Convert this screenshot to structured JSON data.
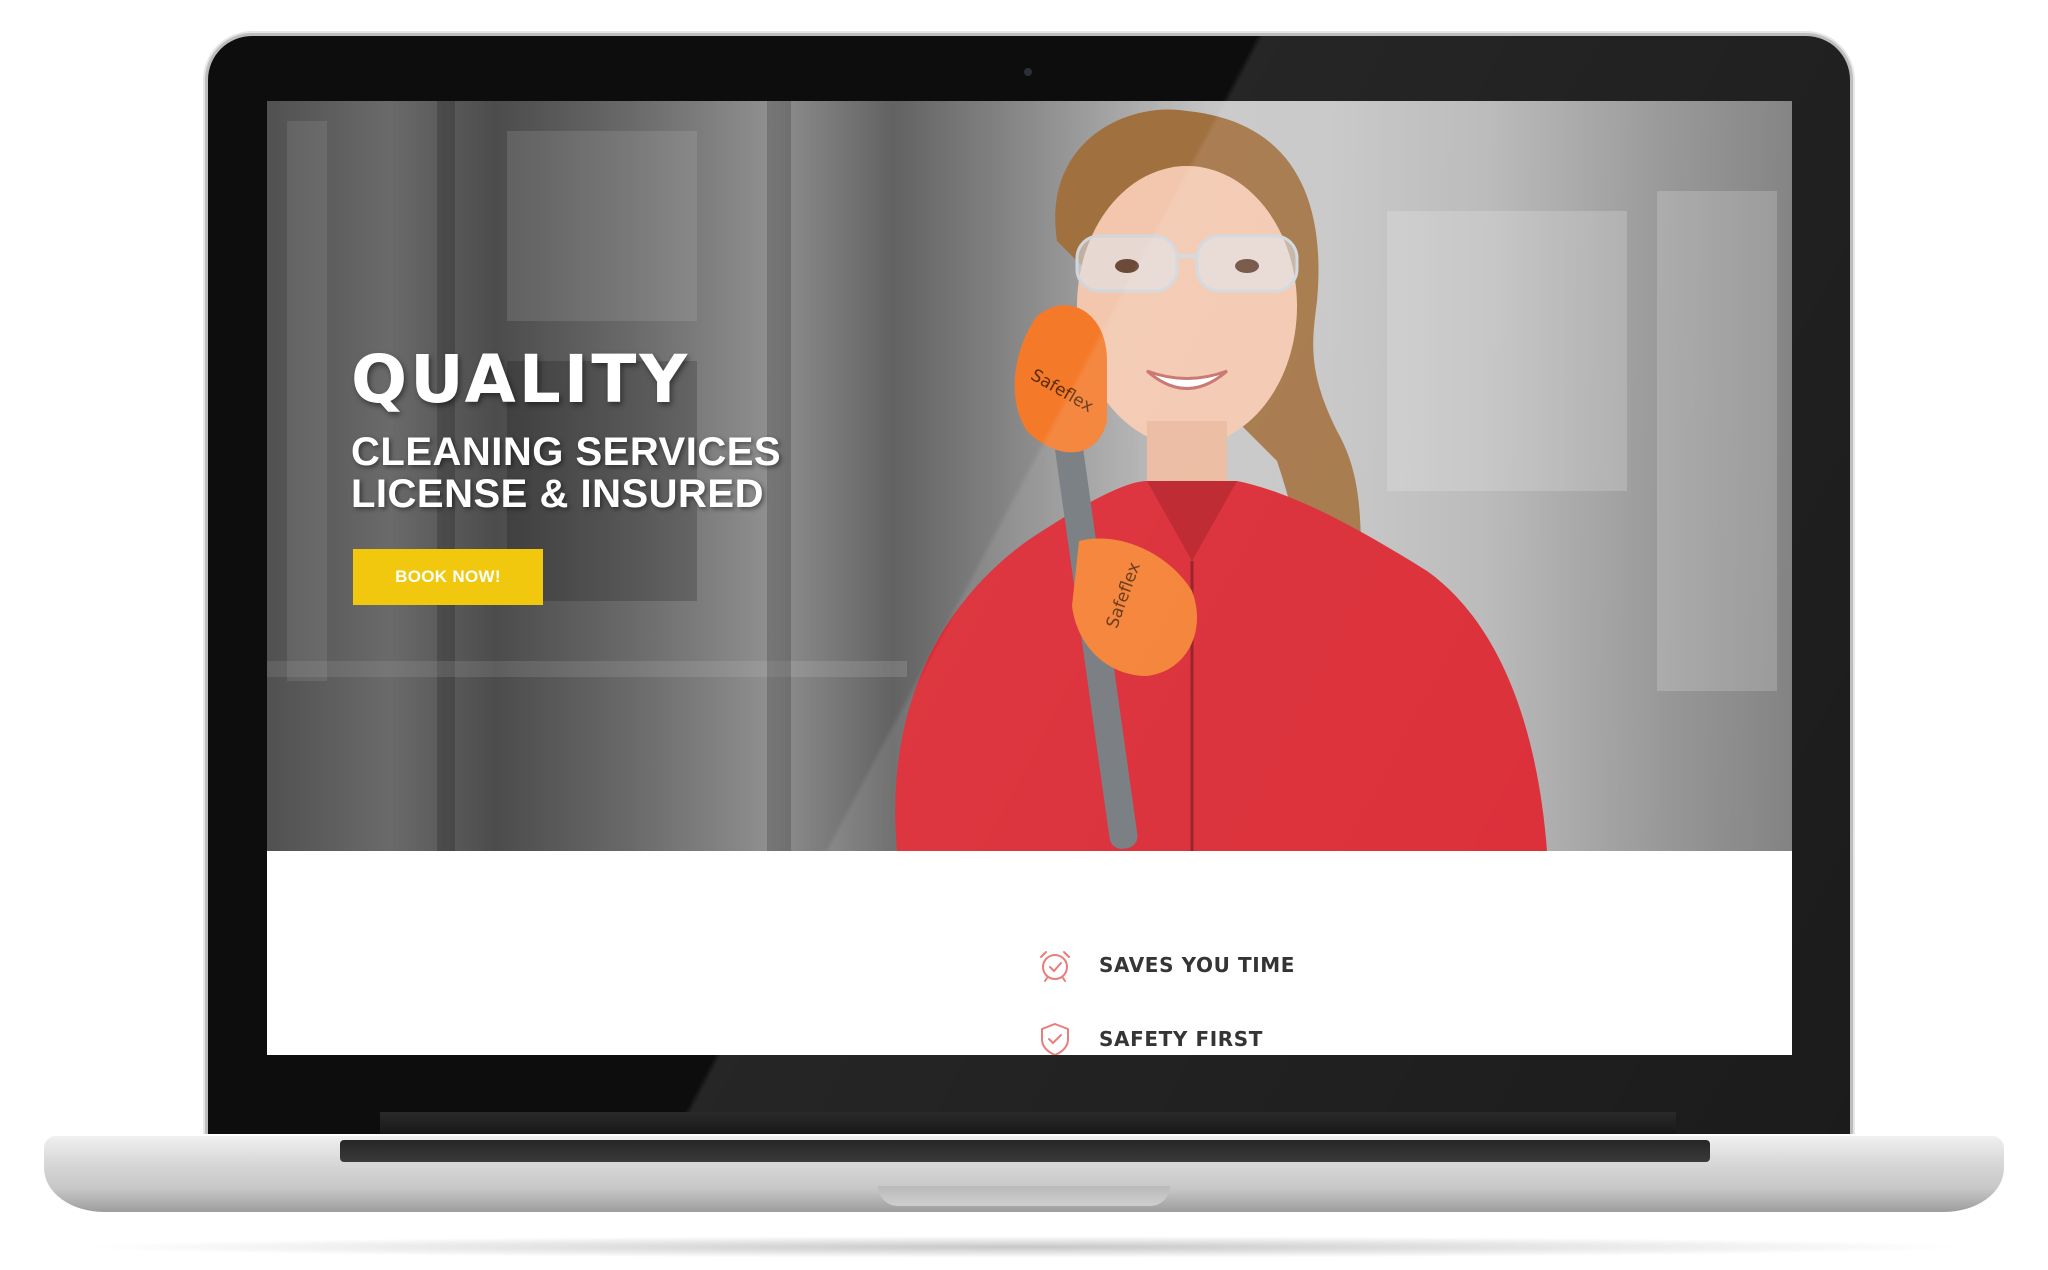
{
  "hero": {
    "title": "QUALITY",
    "subtitle_line1": "CLEANING SERVICES",
    "subtitle_line2": "LICENSE & INSURED",
    "cta_label": "BOOK NOW!"
  },
  "features": [
    {
      "icon": "alarm-clock-icon",
      "label": "SAVES YOU TIME"
    },
    {
      "icon": "shield-check-icon",
      "label": "SAFETY FIRST"
    }
  ],
  "glove_text": "Safeflex",
  "colors": {
    "accent": "#f2c80f",
    "jacket": "#d9202b",
    "glove": "#f47a2a",
    "icon": "#e8706e",
    "text_dark": "#222222"
  }
}
